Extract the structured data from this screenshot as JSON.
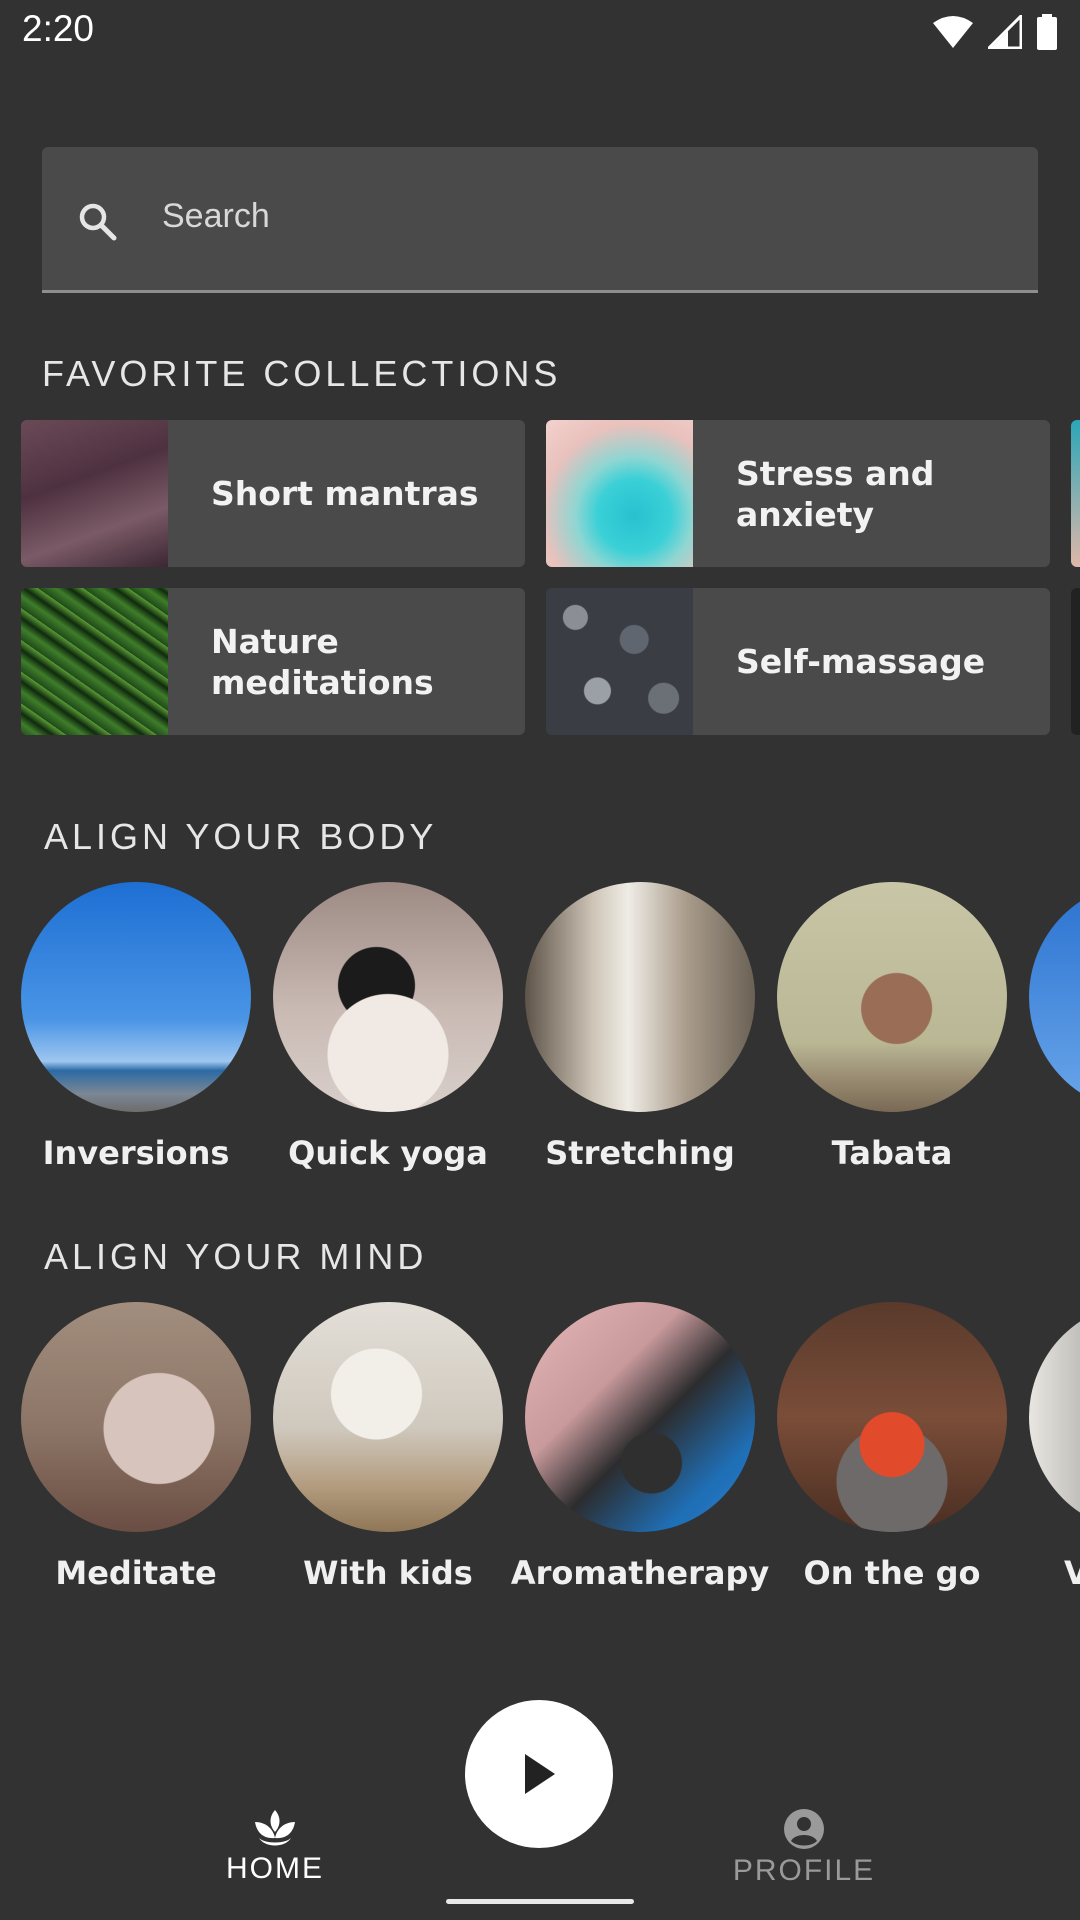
{
  "status_bar": {
    "time": "2:20"
  },
  "search": {
    "placeholder": "Search"
  },
  "favorite_collections": {
    "title": "FAVORITE COLLECTIONS",
    "items": [
      {
        "label": "Short mantras"
      },
      {
        "label": "Stress and\nanxiety"
      },
      {
        "label": "Nature\nmeditations"
      },
      {
        "label": "Self-massage"
      }
    ]
  },
  "align_body": {
    "title": "ALIGN YOUR BODY",
    "items": [
      {
        "label": "Inversions"
      },
      {
        "label": "Quick yoga"
      },
      {
        "label": "Stretching"
      },
      {
        "label": "Tabata"
      }
    ]
  },
  "align_mind": {
    "title": "ALIGN YOUR MIND",
    "items": [
      {
        "label": "Meditate"
      },
      {
        "label": "With kids"
      },
      {
        "label": "Aromatherapy"
      },
      {
        "label": "On the go"
      },
      {
        "label": "V"
      }
    ]
  },
  "bottom_nav": {
    "home_label": "HOME",
    "profile_label": "PROFILE"
  },
  "colors": {
    "background": "#323232",
    "surface": "#4a4a4a",
    "active": "#ffffff",
    "inactive": "#9a9a9a"
  }
}
